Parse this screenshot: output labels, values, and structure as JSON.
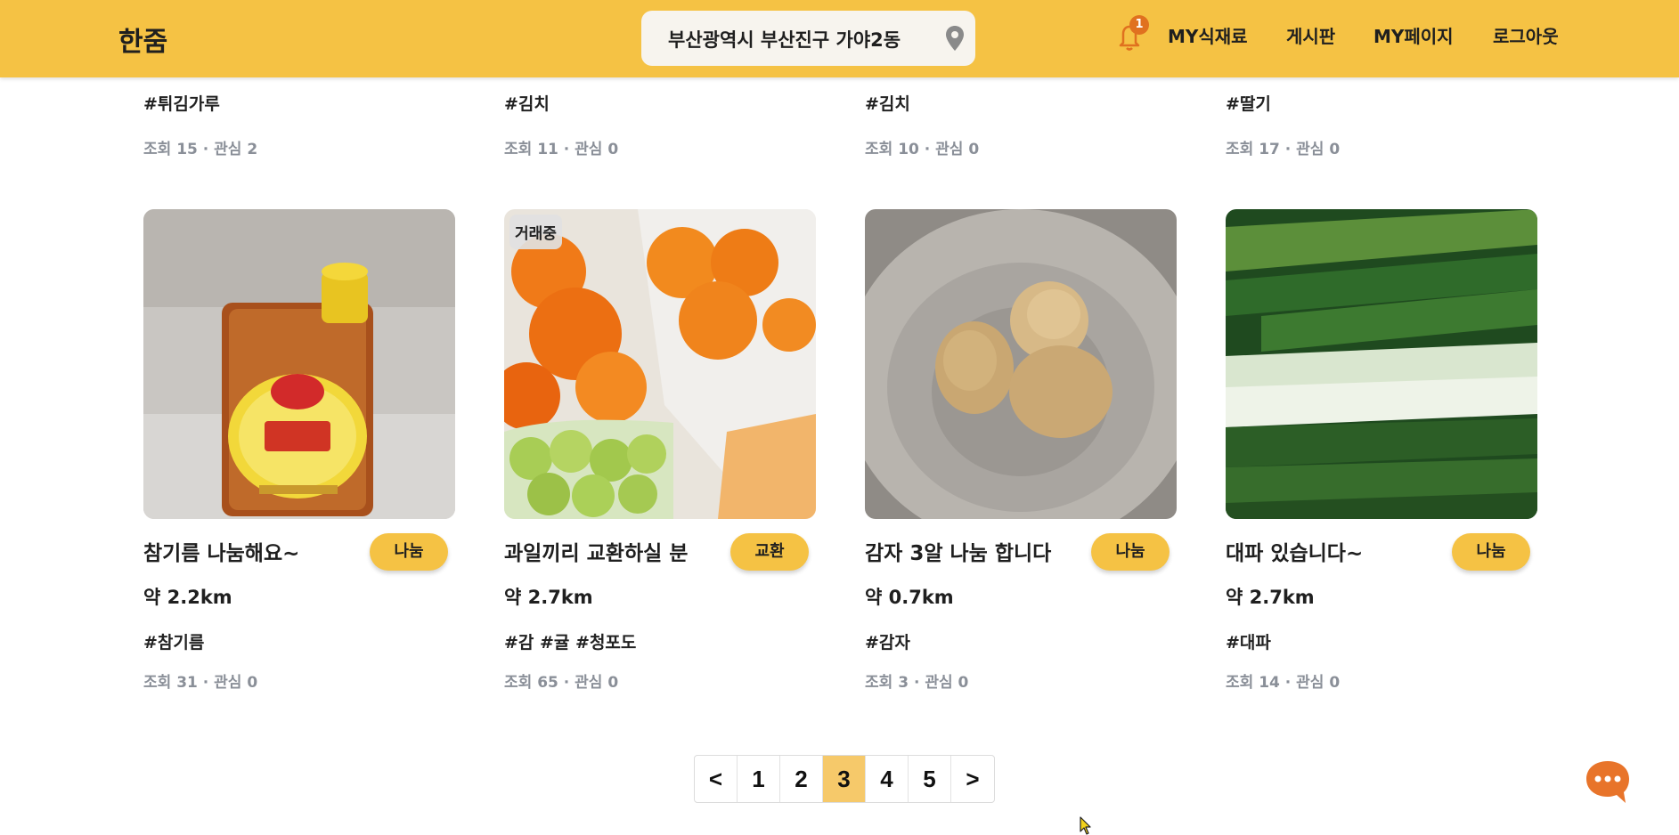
{
  "header": {
    "logo": "한줌",
    "location": "부산광역시 부산진구 가야2동",
    "notification_count": "1",
    "nav": [
      "MY식재료",
      "게시판",
      "MY페이지",
      "로그아웃"
    ]
  },
  "previous_row": [
    {
      "tags": "#튀김가루",
      "meta": "조회 15 · 관심 2"
    },
    {
      "tags": "#김치",
      "meta": "조회 11 · 관심 0"
    },
    {
      "tags": "#김치",
      "meta": "조회 10 · 관심 0"
    },
    {
      "tags": "#딸기",
      "meta": "조회 17 · 관심 0"
    }
  ],
  "cards": [
    {
      "title": "참기름 나눔해요~",
      "type": "나눔",
      "status": "",
      "distance": "약 2.2km",
      "tags": "#참기름",
      "meta": "조회 31 · 관심 0"
    },
    {
      "title": "과일끼리 교환하실 분",
      "type": "교환",
      "status": "거래중",
      "distance": "약 2.7km",
      "tags": "#감 #귤 #청포도",
      "meta": "조회 65 · 관심 0"
    },
    {
      "title": "감자 3알 나눔 합니다",
      "type": "나눔",
      "status": "",
      "distance": "약 0.7km",
      "tags": "#감자",
      "meta": "조회 3 · 관심 0"
    },
    {
      "title": "대파 있습니다~",
      "type": "나눔",
      "status": "",
      "distance": "약 2.7km",
      "tags": "#대파",
      "meta": "조회 14 · 관심 0"
    }
  ],
  "pagination": {
    "prev": "<",
    "pages": [
      "1",
      "2",
      "3",
      "4",
      "5"
    ],
    "current": "3",
    "next": ">"
  },
  "colors": {
    "brand": "#f5c244",
    "active_page": "#f6c96a",
    "chat_fab": "#e8742a",
    "meta_text": "#8a8f98"
  },
  "icons": {
    "location": "map-pin-icon",
    "notifications": "bell-icon",
    "chat": "chat-bubble-icon"
  }
}
